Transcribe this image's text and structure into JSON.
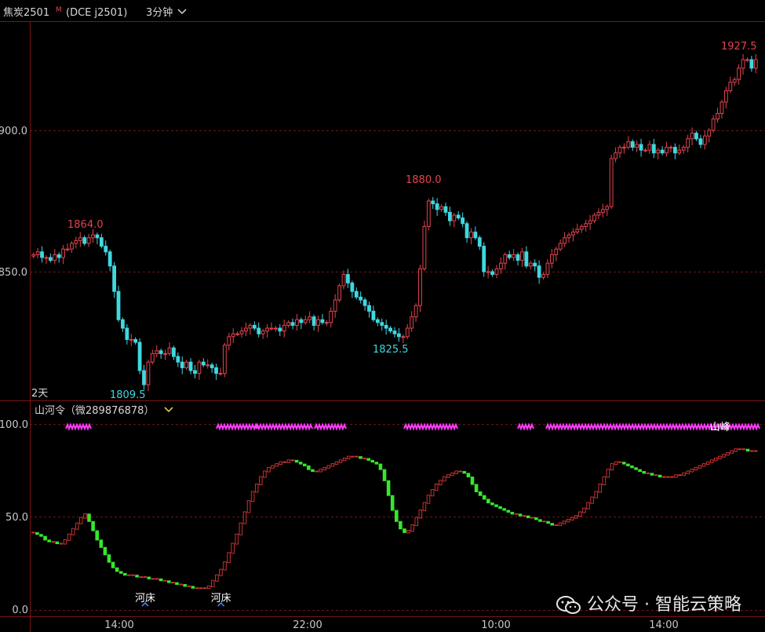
{
  "header": {
    "instrument": "焦炭2501",
    "marker": "M",
    "exchange_code": "(DCE j2501)",
    "period": "3分钟",
    "period_chevron_icon": "chevron-down-icon"
  },
  "price_axis": {
    "ticks": [
      "900.0",
      "850.0"
    ],
    "tick_values": [
      900,
      850
    ]
  },
  "price_annotations": [
    {
      "text": "1864.0",
      "type": "high"
    },
    {
      "text": "1809.5",
      "type": "low"
    },
    {
      "text": "1880.0",
      "type": "high"
    },
    {
      "text": "1825.5",
      "type": "low"
    },
    {
      "text": "1927.5",
      "type": "high"
    }
  ],
  "range_label": "2天",
  "indicator": {
    "name": "山河令（微289876878）",
    "chevron_icon": "chevron-down-icon",
    "axis_ticks": [
      "100.0",
      "50.0",
      "0.0"
    ],
    "labels": {
      "riverbed": "河床",
      "peak": "山峰"
    }
  },
  "time_axis": {
    "labels": [
      "14:00",
      "22:00",
      "10:00",
      "14:00"
    ]
  },
  "watermark": {
    "icon": "wechat-icon",
    "text": "公众号 · 智能云策略"
  },
  "colors": {
    "background": "#000000",
    "up": "#e5434f",
    "down": "#3fd8e0",
    "indicator_up": "#c83232",
    "indicator_down": "#35e82c",
    "magenta": "#ff3cff",
    "border": "#7a1515",
    "grid": "#6a1818",
    "header_yellow": "#ffd84a"
  },
  "chart_data": [
    {
      "type": "candlestick",
      "title": "",
      "xlabel": "",
      "ylabel": "",
      "ylim": [
        1800,
        1935
      ],
      "x_tick_labels": [
        "14:00",
        "22:00",
        "10:00",
        "14:00"
      ],
      "y_tick_labels": [
        "900.0",
        "850.0"
      ],
      "annotations": [
        "1864.0",
        "1809.5",
        "1880.0",
        "1825.5",
        "1927.5"
      ],
      "series": [
        {
          "close": [
            1856,
            1857,
            1855,
            1855,
            1854,
            1856,
            1855,
            1858,
            1858,
            1860,
            1861,
            1862,
            1860,
            1862,
            1863,
            1862,
            1859,
            1857,
            1852,
            1843,
            1833,
            1830,
            1826,
            1826,
            1825,
            1815,
            1810,
            1818,
            1821,
            1822,
            1821,
            1821,
            1823,
            1820,
            1818,
            1816,
            1818,
            1815,
            1814,
            1818,
            1817,
            1817,
            1816,
            1814,
            1814,
            1824,
            1827,
            1828,
            1828,
            1829,
            1830,
            1831,
            1830,
            1828,
            1829,
            1830,
            1830,
            1830,
            1829,
            1831,
            1832,
            1831,
            1833,
            1832,
            1833,
            1834,
            1831,
            1833,
            1832,
            1832,
            1836,
            1840,
            1845,
            1849,
            1846,
            1843,
            1841,
            1840,
            1838,
            1836,
            1833,
            1832,
            1831,
            1830,
            1829,
            1828,
            1827,
            1827,
            1830,
            1834,
            1838,
            1851,
            1866,
            1875,
            1874,
            1872,
            1873,
            1871,
            1868,
            1870,
            1869,
            1867,
            1862,
            1864,
            1862,
            1859,
            1850,
            1850,
            1849,
            1851,
            1853,
            1856,
            1855,
            1856,
            1854,
            1857,
            1852,
            1853,
            1852,
            1848,
            1849,
            1853,
            1856,
            1858,
            1860,
            1862,
            1863,
            1864,
            1865,
            1866,
            1867,
            1868,
            1870,
            1871,
            1872,
            1873,
            1890,
            1892,
            1894,
            1894,
            1896,
            1894,
            1895,
            1893,
            1893,
            1895,
            1892,
            1893,
            1892,
            1894,
            1894,
            1892,
            1893,
            1894,
            1897,
            1899,
            1897,
            1895,
            1898,
            1900,
            1904,
            1906,
            1910,
            1914,
            1917,
            1918,
            1922,
            1925,
            1925,
            1922,
            1925
          ]
        }
      ]
    },
    {
      "type": "bar",
      "title": "",
      "xlabel": "",
      "ylabel": "",
      "ylim": [
        0,
        100
      ],
      "y_tick_labels": [
        "100.0",
        "50.0",
        "0.0"
      ],
      "annotations": [
        "河床",
        "河床",
        "山峰"
      ],
      "series": [
        {
          "values": [
            42,
            41,
            40,
            38,
            37,
            37,
            36,
            36,
            38,
            41,
            44,
            47,
            50,
            52,
            48,
            43,
            38,
            34,
            30,
            26,
            23,
            21,
            20,
            19,
            19,
            19,
            18,
            18,
            18,
            17,
            17,
            17,
            16,
            16,
            15,
            15,
            14,
            14,
            13,
            13,
            12,
            12,
            12,
            12,
            13,
            16,
            19,
            22,
            26,
            31,
            36,
            41,
            47,
            53,
            59,
            64,
            68,
            72,
            75,
            77,
            78,
            79,
            80,
            80,
            81,
            81,
            80,
            79,
            78,
            76,
            75,
            75,
            76,
            77,
            78,
            79,
            80,
            81,
            82,
            83,
            83,
            83,
            82,
            82,
            81,
            80,
            79,
            76,
            70,
            62,
            54,
            48,
            44,
            42,
            43,
            46,
            50,
            54,
            58,
            62,
            65,
            68,
            70,
            72,
            73,
            74,
            75,
            75,
            74,
            72,
            68,
            64,
            62,
            60,
            58,
            57,
            56,
            55,
            54,
            53,
            52,
            52,
            51,
            51,
            50,
            50,
            49,
            48,
            48,
            47,
            46,
            46,
            47,
            48,
            49,
            50,
            51,
            53,
            55,
            58,
            61,
            64,
            68,
            72,
            76,
            79,
            80,
            80,
            79,
            78,
            77,
            76,
            75,
            74,
            74,
            73,
            73,
            72,
            72,
            72,
            72,
            73,
            73,
            74,
            75,
            76,
            77,
            78,
            79,
            80,
            81,
            82,
            83,
            84,
            85,
            86,
            87,
            87,
            87,
            86,
            86,
            86
          ],
          "markers": [
            {
              "index": 28,
              "label": "河床"
            },
            {
              "index": 47,
              "label": "河床"
            },
            {
              "index": 172,
              "label": "山峰"
            }
          ]
        }
      ]
    }
  ]
}
